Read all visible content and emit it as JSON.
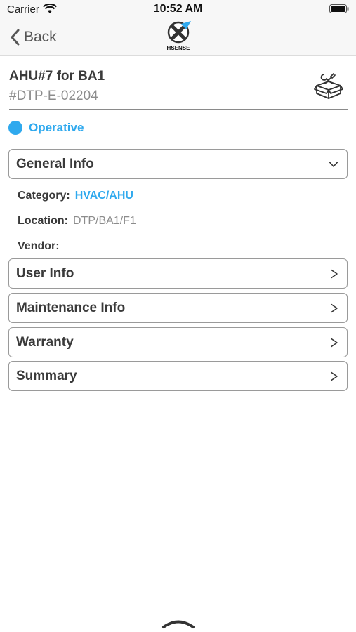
{
  "status_bar": {
    "carrier": "Carrier",
    "time": "10:52 AM",
    "icons": [
      "wifi-icon",
      "battery-icon"
    ]
  },
  "nav": {
    "back_label": "Back",
    "logo_text": "HSENSE",
    "logo_icon": "x-logo-icon"
  },
  "asset": {
    "title": "AHU#7 for BA1",
    "code": "#DTP-E-02204",
    "action_icon": "tools-box-icon"
  },
  "status": {
    "label": "Operative",
    "color": "#2fa9ee"
  },
  "general_info": {
    "label": "General Info",
    "expanded": true,
    "fields": {
      "category_label": "Category:",
      "category_value": "HVAC/AHU",
      "location_label": "Location:",
      "location_value": "DTP/BA1/F1",
      "vendor_label": "Vendor:",
      "vendor_value": ""
    }
  },
  "sections": {
    "user_info": "User Info",
    "maintenance_info": "Maintenance Info",
    "warranty": "Warranty",
    "summary": "Summary"
  },
  "colors": {
    "accent": "#2fa9ee",
    "bar_background": "#f7f7f7",
    "text": "#3a3a3a",
    "muted": "#8c8c8c"
  }
}
